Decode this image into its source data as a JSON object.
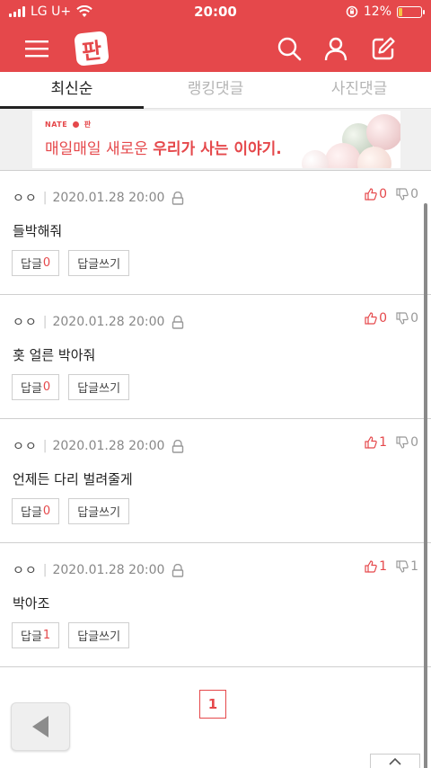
{
  "status": {
    "carrier": "LG U+",
    "time": "20:00",
    "battery": "12%"
  },
  "tabs": [
    {
      "label": "최신순"
    },
    {
      "label": "랭킹댓글"
    },
    {
      "label": "사진댓글"
    }
  ],
  "banner": {
    "brand": "NATE",
    "brand_sub": "판",
    "text_plain": "매일매일 새로운 ",
    "text_bold": "우리가 사는 이야기."
  },
  "comments": [
    {
      "author": "ㅇㅇ",
      "date": "2020.01.28 20:00",
      "text": "들박해줘",
      "up": "0",
      "down": "0",
      "reply_label": "답글",
      "reply_count": "0",
      "write_label": "답글쓰기"
    },
    {
      "author": "ㅇㅇ",
      "date": "2020.01.28 20:00",
      "text": "홋 얼른 박아줘",
      "up": "0",
      "down": "0",
      "reply_label": "답글",
      "reply_count": "0",
      "write_label": "답글쓰기"
    },
    {
      "author": "ㅇㅇ",
      "date": "2020.01.28 20:00",
      "text": "언제든 다리 벌려줄게",
      "up": "1",
      "down": "0",
      "reply_label": "답글",
      "reply_count": "0",
      "write_label": "답글쓰기"
    },
    {
      "author": "ㅇㅇ",
      "date": "2020.01.28 20:00",
      "text": "박아조",
      "up": "1",
      "down": "1",
      "reply_label": "답글",
      "reply_count": "1",
      "write_label": "답글쓰기"
    }
  ],
  "pagination": {
    "current": "1"
  },
  "colors": {
    "brand": "#e5484b",
    "battery_low": "#f6c343"
  },
  "icons": {
    "menu": "hamburger-icon",
    "logo": "pan-logo",
    "search": "search-icon",
    "user": "user-icon",
    "write": "compose-icon",
    "lock": "lock-icon",
    "up": "thumbs-up-icon",
    "down": "thumbs-down-icon",
    "back": "back-arrow-icon",
    "top": "chevron-up-icon"
  }
}
